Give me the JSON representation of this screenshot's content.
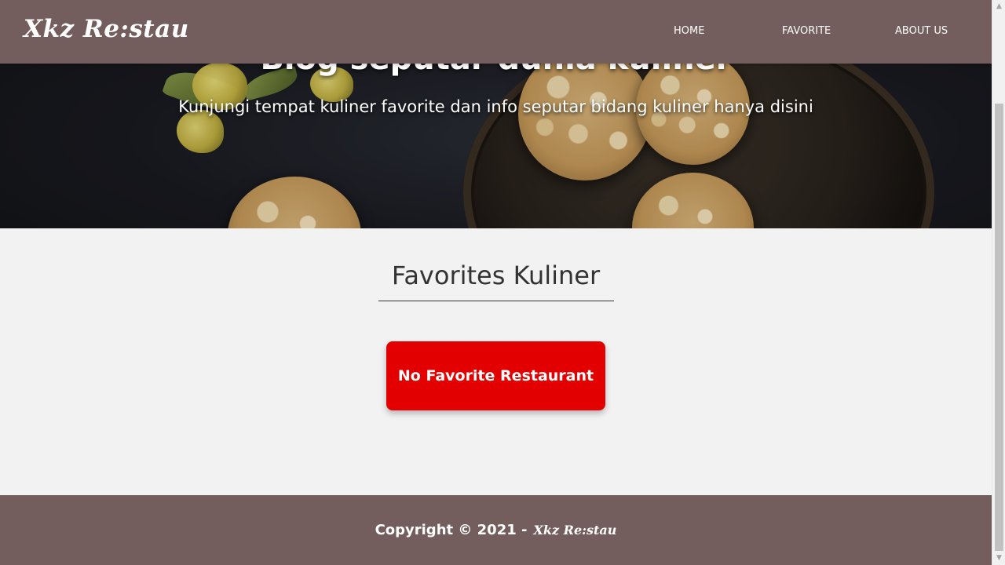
{
  "navbar": {
    "brand": "Xkz Re:stau",
    "links": [
      {
        "label": "HOME"
      },
      {
        "label": "FAVORITE"
      },
      {
        "label": "ABOUT US"
      }
    ]
  },
  "hero": {
    "title": "Blog seputar dunia kuliner",
    "subtitle": "Kunjungi tempat kuliner favorite dan info seputar bidang kuliner hanya disini"
  },
  "main": {
    "title": "Favorites Kuliner",
    "empty_message": "No Favorite Restaurant"
  },
  "footer": {
    "copyright": "Copyright © 2021 -",
    "brand": "Xkz Re:stau"
  },
  "colors": {
    "navbar": "#735e5d",
    "footer": "#735e5d",
    "empty_box": "#e30000",
    "background": "#f2f2f2"
  },
  "icons": {
    "scroll_up": "triangle-up-icon",
    "scroll_down": "triangle-down-icon"
  }
}
